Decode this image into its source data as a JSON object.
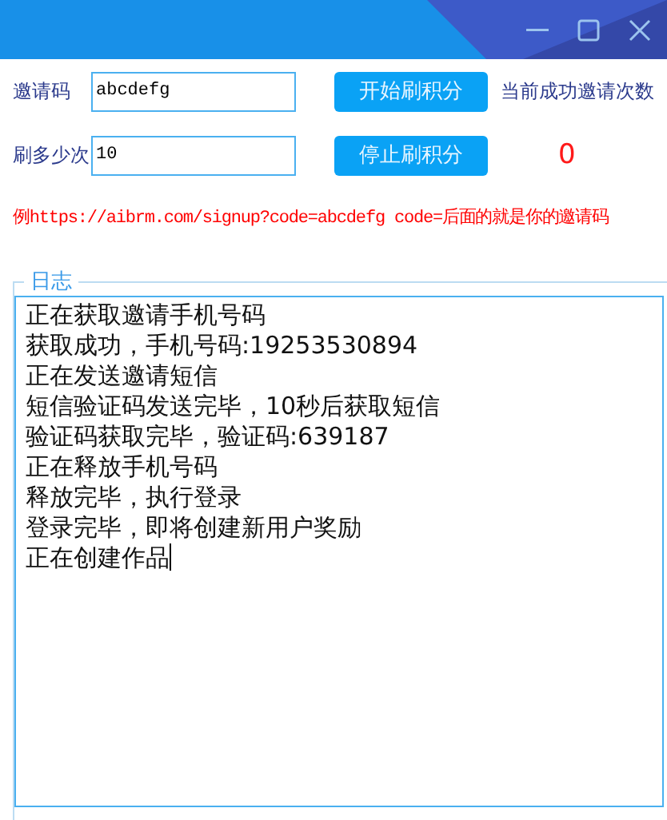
{
  "form": {
    "invite_code": {
      "label": "邀请码",
      "value": "abcdefg"
    },
    "count": {
      "label": "刷多少次",
      "value": "10"
    },
    "buttons": [
      {
        "label": "开始刷积分"
      },
      {
        "label": "停止刷积分"
      }
    ],
    "success_label": "当前成功邀请次数",
    "success_count": "0"
  },
  "hint": "例https://aibrm.com/signup?code=abcdefg  code=后面的就是你的邀请码",
  "log": {
    "title": "日志",
    "lines": [
      "正在获取邀请手机号码",
      "获取成功，手机号码:19253530894",
      "正在发送邀请短信",
      "短信验证码发送完毕，10秒后获取短信",
      "验证码获取完毕，验证码:639187",
      "正在释放手机号码",
      "释放完毕，执行登录",
      "登录完毕，即将创建新用户奖励",
      "正在创建作品"
    ],
    "focused": true
  }
}
